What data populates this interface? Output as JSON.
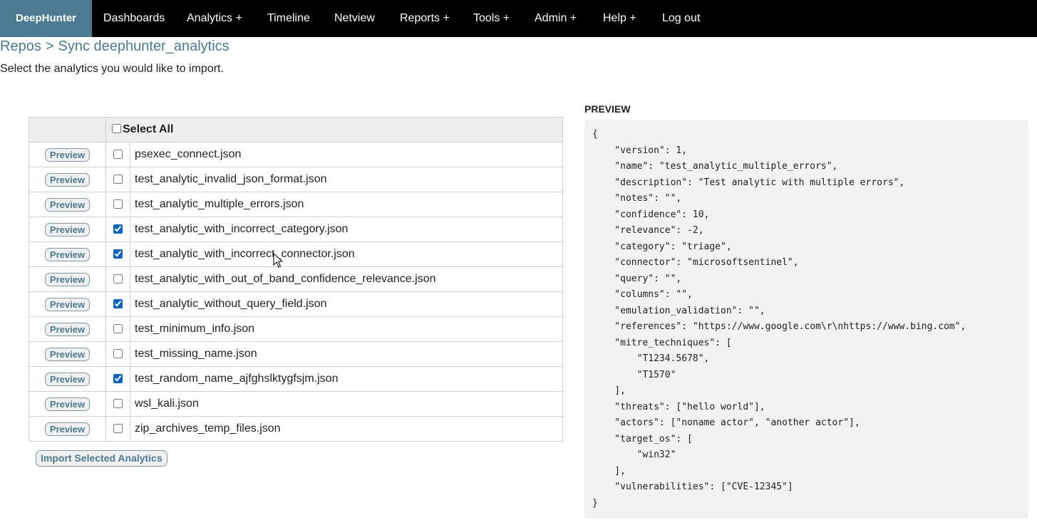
{
  "nav": {
    "brand": "DeepHunter",
    "items": [
      {
        "label": "Dashboards"
      },
      {
        "label": "Analytics +"
      },
      {
        "label": "Timeline"
      },
      {
        "label": "Netview"
      },
      {
        "label": "Reports +"
      },
      {
        "label": "Tools +"
      },
      {
        "label": "Admin +"
      },
      {
        "label": "Help +"
      },
      {
        "label": "Log out"
      }
    ]
  },
  "breadcrumb": {
    "root": "Repos",
    "separator": ">",
    "current": "Sync deephunter_analytics"
  },
  "subtitle": "Select the analytics you would like to import.",
  "table": {
    "select_all_label": "Select All",
    "select_all_checked": false,
    "preview_label": "Preview",
    "rows": [
      {
        "file": "psexec_connect.json",
        "checked": false
      },
      {
        "file": "test_analytic_invalid_json_format.json",
        "checked": false
      },
      {
        "file": "test_analytic_multiple_errors.json",
        "checked": false
      },
      {
        "file": "test_analytic_with_incorrect_category.json",
        "checked": true
      },
      {
        "file": "test_analytic_with_incorrect_connector.json",
        "checked": true
      },
      {
        "file": "test_analytic_with_out_of_band_confidence_relevance.json",
        "checked": false
      },
      {
        "file": "test_analytic_without_query_field.json",
        "checked": true
      },
      {
        "file": "test_minimum_info.json",
        "checked": false
      },
      {
        "file": "test_missing_name.json",
        "checked": false
      },
      {
        "file": "test_random_name_ajfghslktygfsjm.json",
        "checked": true
      },
      {
        "file": "wsl_kali.json",
        "checked": false
      },
      {
        "file": "zip_archives_temp_files.json",
        "checked": false
      }
    ]
  },
  "import_button": "Import Selected Analytics",
  "preview": {
    "heading": "PREVIEW",
    "content": "{\n    \"version\": 1,\n    \"name\": \"test_analytic_multiple_errors\",\n    \"description\": \"Test analytic with multiple errors\",\n    \"notes\": \"\",\n    \"confidence\": 10,\n    \"relevance\": -2,\n    \"category\": \"triage\",\n    \"connector\": \"microsoftsentinel\",\n    \"query\": \"\",\n    \"columns\": \"\",\n    \"emulation_validation\": \"\",\n    \"references\": \"https://www.google.com\\r\\nhttps://www.bing.com\",\n    \"mitre_techniques\": [\n        \"T1234.5678\",\n        \"T1570\"\n    ],\n    \"threats\": [\"hello world\"],\n    \"actors\": [\"noname actor\", \"another actor\"],\n    \"target_os\": [\n        \"win32\"\n    ],\n    \"vulnerabilities\": [\"CVE-12345\"]\n}"
  },
  "colors": {
    "brand_bg": "#4a7b93",
    "navbar_bg": "#000000",
    "link": "#4a7b93",
    "preview_bg": "#f2f2f2",
    "table_header_bg": "#eeeeee"
  }
}
